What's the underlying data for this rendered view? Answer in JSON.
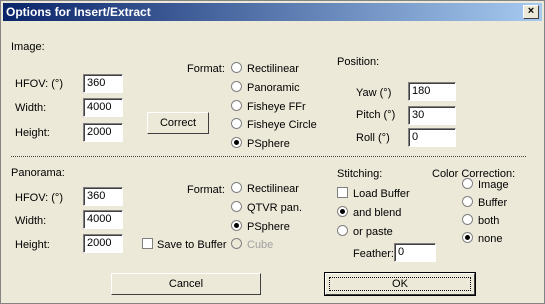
{
  "window": {
    "title": "Options for Insert/Extract",
    "close_icon": "close-icon"
  },
  "image": {
    "section_label": "Image:",
    "hfov_label": "HFOV: (°)",
    "hfov_value": "360",
    "width_label": "Width:",
    "width_value": "4000",
    "height_label": "Height:",
    "height_value": "2000",
    "correct_button": "Correct",
    "format_label": "Format:",
    "formats": [
      "Rectilinear",
      "Panoramic",
      "Fisheye FFr",
      "Fisheye Circle",
      "PSphere"
    ],
    "selected_format": "PSphere",
    "position_label": "Position:",
    "yaw_label": "Yaw (°)",
    "yaw_value": "180",
    "pitch_label": "Pitch (°)",
    "pitch_value": "30",
    "roll_label": "Roll (°)",
    "roll_value": "0"
  },
  "panorama": {
    "section_label": "Panorama:",
    "hfov_label": "HFOV: (°)",
    "hfov_value": "360",
    "width_label": "Width:",
    "width_value": "4000",
    "height_label": "Height:",
    "height_value": "2000",
    "save_to_buffer_label": "Save to Buffer",
    "format_label": "Format:",
    "formats": [
      "Rectilinear",
      "QTVR pan.",
      "PSphere",
      "Cube"
    ],
    "selected_format": "PSphere"
  },
  "stitching": {
    "label": "Stitching:",
    "load_buffer_label": "Load Buffer",
    "and_blend_label": "and blend",
    "or_paste_label": "or paste",
    "selected": "and blend",
    "feather_label": "Feather:",
    "feather_value": "0"
  },
  "color_correction": {
    "label": "Color Correction:",
    "options": [
      "Image",
      "Buffer",
      "both",
      "none"
    ],
    "selected": "none"
  },
  "buttons": {
    "cancel": "Cancel",
    "ok": "OK"
  }
}
